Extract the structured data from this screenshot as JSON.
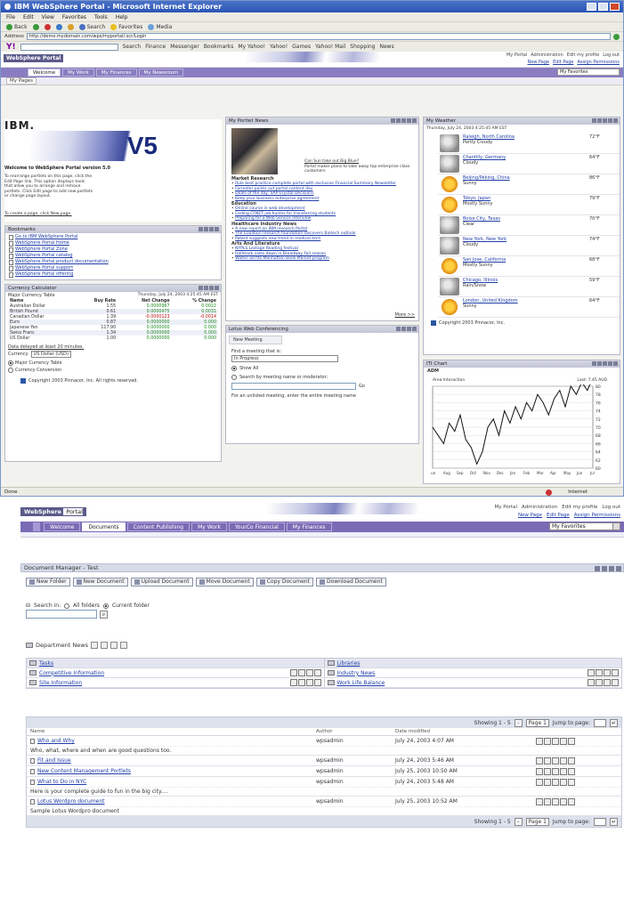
{
  "win1": {
    "title": "IBM WebSphere Portal - Microsoft Internet Explorer",
    "menu": [
      "File",
      "Edit",
      "View",
      "Favorites",
      "Tools",
      "Help"
    ],
    "toolbar": [
      "Back",
      "Search",
      "Favorites",
      "Media"
    ],
    "address_label": "Address",
    "address_value": "http://demo.mydomain.com/wps/myportal/.scr/Login",
    "yahoo": {
      "search_label": "Search",
      "items": [
        "Finance",
        "Messenger",
        "Bookmarks",
        "My Yahoo!",
        "Yahoo!",
        "Games",
        "Yahoo! Mail",
        "Shopping",
        "News"
      ]
    },
    "portal": {
      "logo": "WebSphere Portal",
      "toplinks": [
        "My Portal",
        "Administration",
        "Edit my profile",
        "Log out"
      ],
      "sublinks": [
        "New Page",
        "Edit Page",
        "Assign Permissions"
      ],
      "tabs": [
        "Welcome",
        "My Work",
        "My Finances",
        "My Newsroom"
      ],
      "favorites": "My Favorites",
      "page_tab": "My Pages"
    },
    "welcome": {
      "ibm": "IBM.",
      "version": "V5",
      "heading": "Welcome to WebSphere Portal version 5.0",
      "body": "To rearrange portlets on this page, click the Edit Page link. This option displays tools that allow you to arrange and remove portlets. Click Edit page to add new portlets or change page layout.",
      "footer": "To create a page, click New page."
    },
    "bookmarks": {
      "title": "Bookmarks",
      "items": [
        "Go to IBM WebSphere Portal",
        "WebSphere Portal Home",
        "WebSphere Portal Zone",
        "WebSphere Portal catalog",
        "WebSphere Portal product documentation",
        "WebSphere Portal support",
        "WebSphere Portal offering"
      ]
    },
    "currency": {
      "title": "Currency Calculator",
      "table_title": "Major Currency Table",
      "timestamp": "Thursday, July 24, 2003 4:25:45 AM EST",
      "headers": [
        "Name",
        "Buy Rate",
        "Net Change",
        "% Change"
      ],
      "rows": [
        [
          "Australian Dollar",
          "1.55",
          "0.0000967",
          "0.0022"
        ],
        [
          "British Pound",
          "0.61",
          "0.0000475",
          "0.0031"
        ],
        [
          "Canadian Dollar",
          "1.39",
          "-0.0000123",
          "-0.0014"
        ],
        [
          "Euro",
          "0.87",
          "0.0000000",
          "0.000"
        ],
        [
          "Japanese Yen",
          "117.90",
          "0.0000000",
          "0.000"
        ],
        [
          "Swiss Franc",
          "1.34",
          "0.0000000",
          "0.000"
        ],
        [
          "US Dollar",
          "1.00",
          "0.0000000",
          "0.000"
        ]
      ],
      "note": "Data delayed at least 20 minutes.",
      "currency_label": "Currency",
      "currency_value": "US Dollar (USD)",
      "opt1": "Major Currency Table",
      "opt2": "Currency Conversion",
      "copyright": "Copyright 2003 Pinnacor, Inc. All rights reserved."
    },
    "news": {
      "title": "My Portlet News",
      "caption": "Can Sun take out Big Blue?",
      "caption_sub": "Portal maker plans to take away top enterprise class customers",
      "sections": [
        {
          "h": "Market Research",
          "items": [
            "Rule best practice complete portal with exclusive Financial Summary Newsletter",
            "Forrester points out portal content dev",
            "Deals of the day: SAP Crystal Decisions",
            "Keep your business enterprise agreement"
          ]
        },
        {
          "h": "Education",
          "items": [
            "Online course in web development",
            "Ceding CFNET job hunter for transferring students",
            "Preparing for a Web Service Interview"
          ]
        },
        {
          "h": "Healthcare Industry News",
          "items": [
            "A new report on IBM research Portal",
            "The Coalition research foundation discovers Biotech outlook",
            "Patent suggests new trend in medical tech"
          ]
        },
        {
          "h": "Arts And Literature",
          "items": [
            "NYPLS Lestage Reading festival",
            "Hallmark sales down in Broadway Fall season",
            "Walter ad fits Manhattan Book Market program"
          ]
        }
      ],
      "more": "More >>"
    },
    "weather": {
      "title": "My Weather",
      "date": "Thursday, July 24, 2003 4:25:45 AM EST",
      "rows": [
        {
          "city": "Raleigh, North Carolina",
          "cond": "Partly Cloudy",
          "temp": "72°F",
          "icon": "cloud"
        },
        {
          "city": "Chantilly, Germany",
          "cond": "Cloudy",
          "temp": "64°F",
          "icon": "cloud"
        },
        {
          "city": "Beijing/Peking, China",
          "cond": "Sunny",
          "temp": "86°F",
          "icon": "sun"
        },
        {
          "city": "Tokyo, Japan",
          "cond": "Mostly Sunny",
          "temp": "79°F",
          "icon": "sun"
        },
        {
          "city": "Boise City, Texas",
          "cond": "Clear",
          "temp": "70°F",
          "icon": "cloud"
        },
        {
          "city": "New York, New York",
          "cond": "Cloudy",
          "temp": "74°F",
          "icon": "cloud"
        },
        {
          "city": "San Jose, California",
          "cond": "Mostly Sunny",
          "temp": "68°F",
          "icon": "sun"
        },
        {
          "city": "Chicago, Illinois",
          "cond": "Rain/Snow",
          "temp": "59°F",
          "icon": "cloud"
        },
        {
          "city": "London, United Kingdom",
          "cond": "Sunny",
          "temp": "64°F",
          "icon": "sun"
        }
      ],
      "copyright": "Copyright 2003 Pinnacor, Inc."
    },
    "lotus": {
      "title": "Lotus Web Conferencing",
      "tab": "New Meeting",
      "label": "Find a meeting that is:",
      "select": "In Progress",
      "opt1": "Show All",
      "opt2": "Search by meeting name or moderator:",
      "go": "Go",
      "hint": "For an unlisted meeting, enter the entire meeting name"
    },
    "stock": {
      "title": "ITI Chart",
      "symbol": "ADM",
      "legend": "Area Interaction",
      "last": "Last: 7.45 AUD",
      "xlabels": [
        "Jun",
        "Aug",
        "Sep",
        "Oct",
        "Nov",
        "Dec",
        "Jan",
        "Feb",
        "Mar",
        "Apr",
        "May",
        "Jun",
        "Jul"
      ],
      "ylabels": [
        "80",
        "78",
        "76",
        "74",
        "72",
        "70",
        "68",
        "66",
        "64",
        "62",
        "60"
      ]
    },
    "status": "Done",
    "status_right": "Internet"
  },
  "win2": {
    "logo": "WebSphere",
    "logo2": "Portal",
    "toplinks": [
      "My Portal",
      "Administration",
      "Edit my profile",
      "Log out"
    ],
    "sublinks": [
      "New Page",
      "Edit Page",
      "Assign Permissions"
    ],
    "tabs": [
      "Welcome",
      "Documents",
      "Content Publishing",
      "My Work",
      "YourCo Financial",
      "My Finances"
    ],
    "favorites": "My Favorites",
    "dm": {
      "title": "Document Manager - Test",
      "buttons": [
        "New Folder",
        "New Document",
        "Upload Document",
        "Move Document",
        "Copy Document",
        "Download Document"
      ],
      "search_label": "Search in:",
      "search_opt1": "All folders",
      "search_opt2": "Current folder",
      "folder": "Department News",
      "grid": [
        [
          "Tasks",
          "Libraries"
        ],
        [
          "Competitive Information",
          "Industry News"
        ],
        [
          "Site Information",
          "Work Life Balance"
        ]
      ],
      "paging": {
        "showing": "Showing 1 - 5",
        "page": "Page 1",
        "jump": "Jump to page:"
      },
      "headers": [
        "Name",
        "Author",
        "Date modified"
      ],
      "rows": [
        {
          "name": "Who and Why",
          "author": "wpsadmin",
          "date": "July 24, 2003 4:07 AM",
          "desc": "Who, what, where and when are good questions too."
        },
        {
          "name": "Fit and Issue",
          "author": "wpsadmin",
          "date": "July 24, 2003 5:46 AM",
          "desc": ""
        },
        {
          "name": "New Content Management Portlets",
          "author": "wpsadmin",
          "date": "July 25, 2003 10:50 AM",
          "desc": ""
        },
        {
          "name": "What to Do in NYC",
          "author": "wpsadmin",
          "date": "July 24, 2003 5:48 AM",
          "desc": "Here is your complete guide to fun in the big city...."
        },
        {
          "name": "Lotus Wordpro document",
          "author": "wpsadmin",
          "date": "July 25, 2003 10:52 AM",
          "desc": "Sample Lotus Wordpro document"
        }
      ]
    }
  },
  "chart_data": {
    "type": "line",
    "title": "ADM",
    "series": [
      {
        "name": "Area Interaction",
        "values": [
          70,
          68,
          66,
          71,
          69,
          73,
          67,
          65,
          61,
          64,
          70,
          72,
          68,
          74,
          71,
          75,
          72,
          76,
          74,
          78,
          76,
          73,
          77,
          79,
          75,
          80,
          78,
          81,
          79,
          82
        ]
      }
    ],
    "x": [
      "Jun",
      "Aug",
      "Sep",
      "Oct",
      "Nov",
      "Dec",
      "Jan",
      "Feb",
      "Mar",
      "Apr",
      "May",
      "Jun",
      "Jul"
    ],
    "ylim": [
      60,
      80
    ]
  }
}
